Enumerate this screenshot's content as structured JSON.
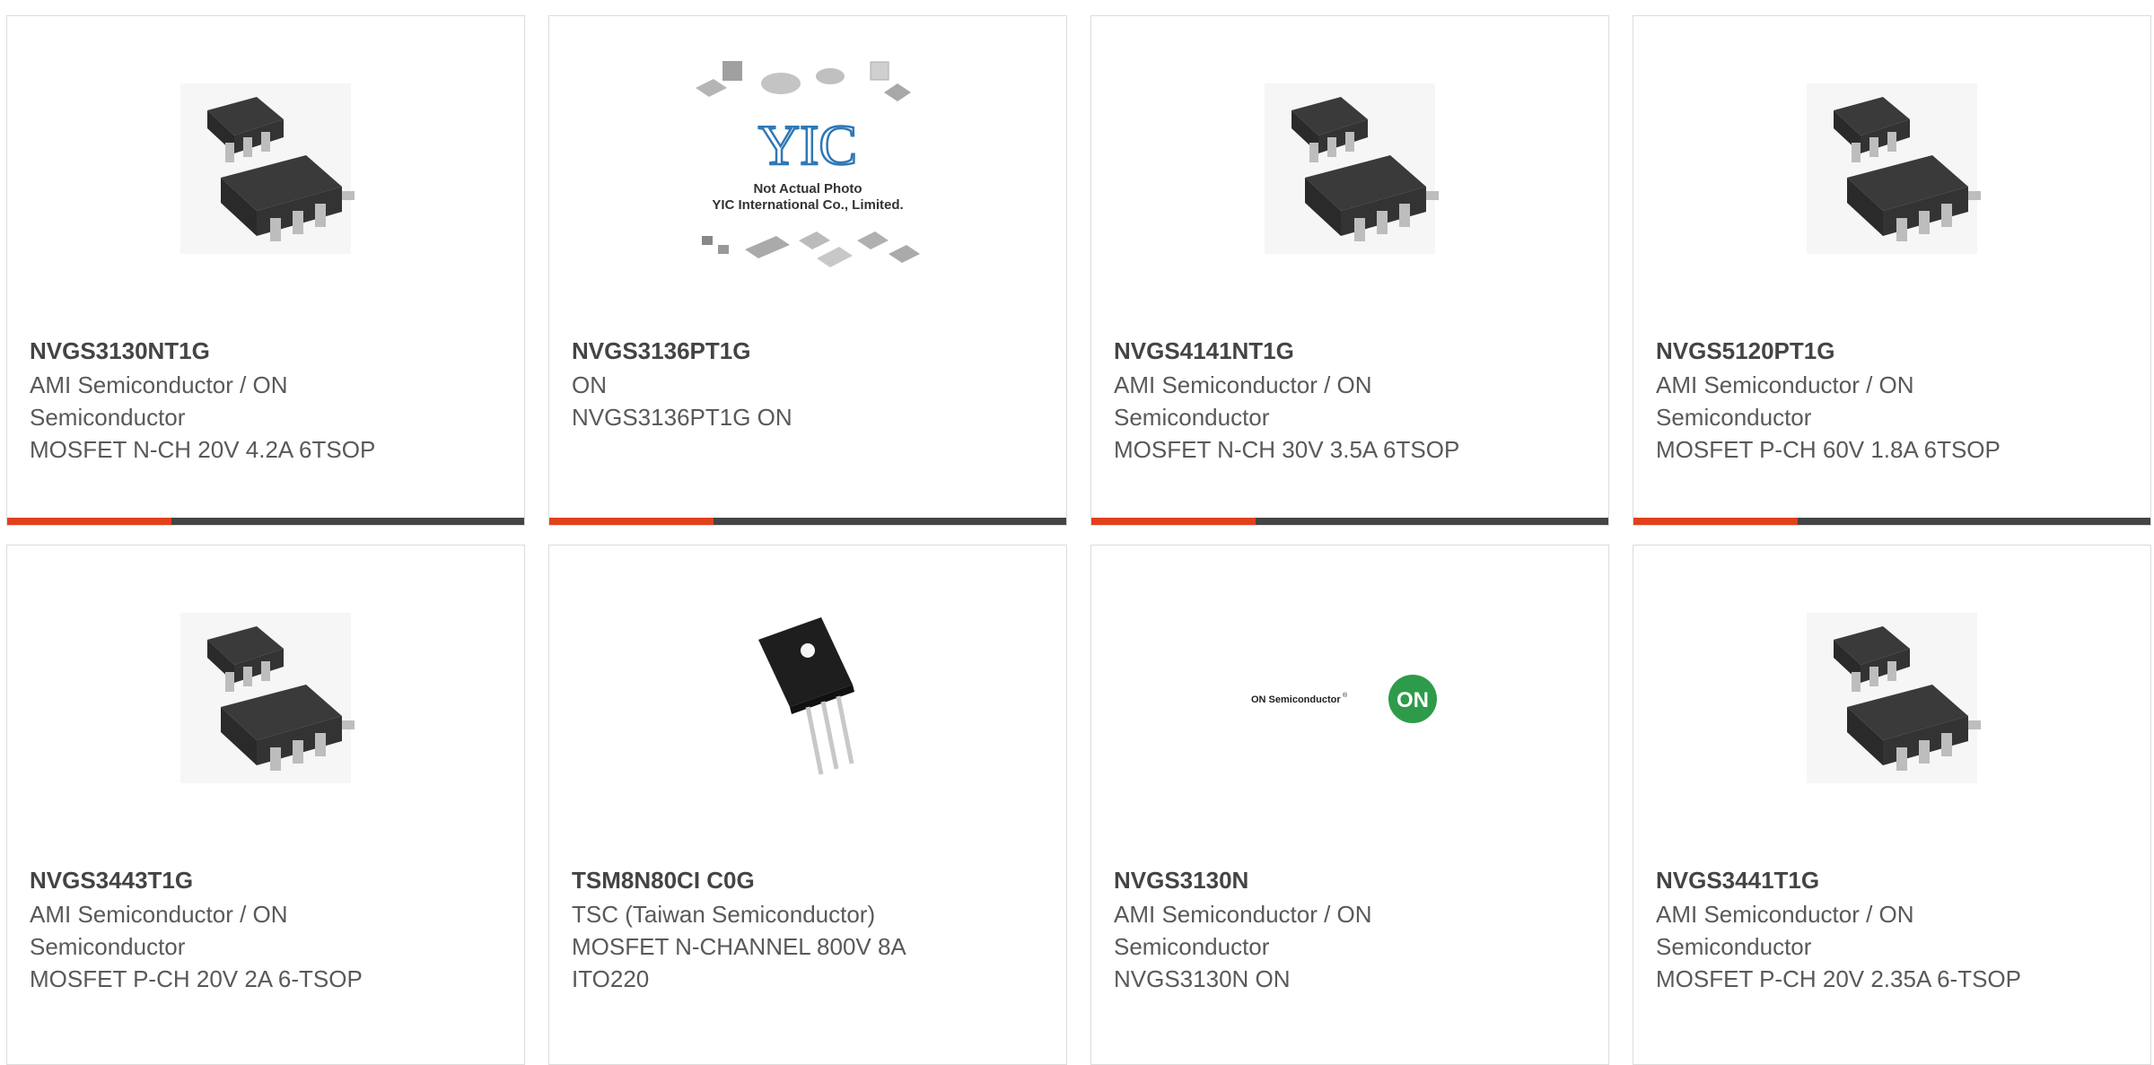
{
  "products": [
    {
      "part": "NVGS3130NT1G",
      "manufacturer": "AMI Semiconductor / ON Semiconductor",
      "description": "MOSFET N-CH 20V 4.2A 6TSOP",
      "image": "tsop6-chip-icon"
    },
    {
      "part": "NVGS3136PT1G",
      "manufacturer": "ON",
      "description": "NVGS3136PT1G ON",
      "image": "not-actual-photo-placeholder",
      "placeholder_text": {
        "line1": "Not Actual Photo",
        "line2": "YIC International Co., Limited.",
        "logo": "YIC"
      }
    },
    {
      "part": "NVGS4141NT1G",
      "manufacturer": "AMI Semiconductor / ON Semiconductor",
      "description": "MOSFET N-CH 30V 3.5A 6TSOP",
      "image": "tsop6-chip-icon"
    },
    {
      "part": "NVGS5120PT1G",
      "manufacturer": "AMI Semiconductor / ON Semiconductor",
      "description": "MOSFET P-CH 60V 1.8A 6TSOP",
      "image": "tsop6-chip-icon"
    },
    {
      "part": "NVGS3443T1G",
      "manufacturer": "AMI Semiconductor / ON Semiconductor",
      "description": "MOSFET P-CH 20V 2A 6-TSOP",
      "image": "tsop6-chip-icon"
    },
    {
      "part": "TSM8N80CI C0G",
      "manufacturer": "TSC (Taiwan Semiconductor)",
      "description": "MOSFET N-CHANNEL 800V 8A ITO220",
      "image": "to220-transistor-icon"
    },
    {
      "part": "NVGS3130N",
      "manufacturer": "AMI Semiconductor / ON Semiconductor",
      "description": "NVGS3130N ON",
      "image": "on-semiconductor-logo",
      "logo_text": {
        "wordmark": "ON Semiconductor",
        "badge": "ON"
      }
    },
    {
      "part": "NVGS3441T1G",
      "manufacturer": "AMI Semiconductor / ON Semiconductor",
      "description": "MOSFET P-CH 20V 2.35A 6-TSOP",
      "image": "tsop6-chip-icon"
    }
  ],
  "colors": {
    "accent": "#e2401c",
    "bar": "#444444",
    "border": "#dcdcdc",
    "part_text": "#444444",
    "body_text": "#595959"
  }
}
